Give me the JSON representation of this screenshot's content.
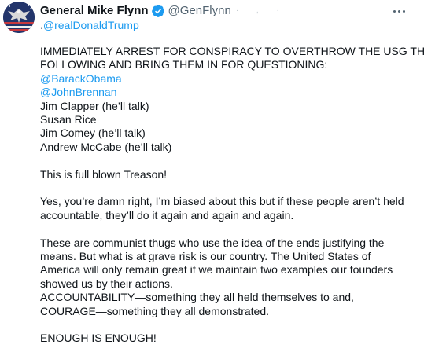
{
  "tweet": {
    "display_name": "General Mike Flynn",
    "handle": "@GenFlynn",
    "faint_marks": "· , ·",
    "reply_prefix": ".",
    "reply_mention": "@realDonaldTrump",
    "lines": [
      "IMMEDIATELY ARREST FOR CONSPIRACY TO OVERTHROW THE USG THE",
      "FOLLOWING AND BRING THEM IN FOR QUESTIONING:"
    ],
    "mention_obama": "@BarackObama",
    "mention_brennan": "@JohnBrennan",
    "names": [
      "Jim Clapper (he’ll talk)",
      "Susan Rice",
      "Jim Comey (he’ll talk)",
      "Andrew McCabe (he’ll talk)"
    ],
    "treason": "This is full blown Treason!",
    "biased": [
      "Yes, you’re damn right, I’m biased about this but if these people aren’t held",
      "accountable, they’ll do it again and again and again."
    ],
    "communist": [
      "These are communist thugs who use the idea of the ends justifying the",
      "means. But what is at grave risk is our country. The United States of",
      "America will only remain great if we maintain two examples our founders",
      "showed us by their actions.",
      "ACCOUNTABILITY—something they all held themselves to and,",
      "COURAGE—something they all demonstrated."
    ],
    "enough": "ENOUGH IS ENOUGH!"
  },
  "colors": {
    "text": "#0f1419",
    "secondary": "#536471",
    "link": "#1d9bf0",
    "verified_badge": "#1d9bf0"
  },
  "icons": {
    "verified": "verified-badge-icon",
    "more": "more-options-icon",
    "avatar": "eagle-flag-avatar"
  }
}
